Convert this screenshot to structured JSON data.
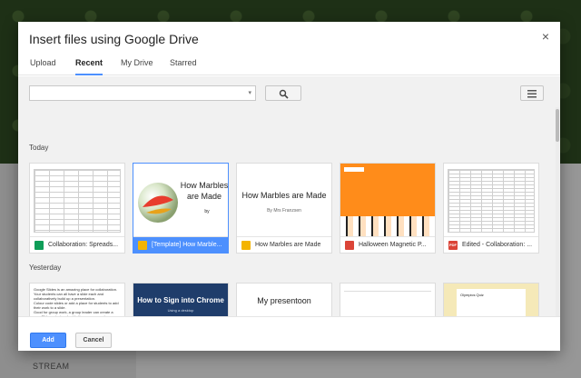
{
  "background": {
    "stream_label": "STREAM"
  },
  "dialog": {
    "title": "Insert files using Google Drive",
    "close_glyph": "×",
    "tabs": [
      {
        "label": "Upload",
        "active": false
      },
      {
        "label": "Recent",
        "active": true
      },
      {
        "label": "My Drive",
        "active": false
      },
      {
        "label": "Starred",
        "active": false
      }
    ],
    "search": {
      "value": "",
      "placeholder": "",
      "caret": "▾",
      "button_icon": "search-icon"
    },
    "view_toggle_icon": "list-view-icon",
    "sections": [
      {
        "label": "Today",
        "files": [
          {
            "name": "Collaboration: Spreads...",
            "type": "sheet",
            "icon": "sheets-icon",
            "selected": false
          },
          {
            "name": "[Template] How Marble...",
            "type": "slide",
            "icon": "slides-icon",
            "selected": true,
            "thumb_title": "How Marbles are Made",
            "thumb_sub": "by"
          },
          {
            "name": "How Marbles are Made",
            "type": "slide",
            "icon": "slides-icon",
            "selected": false,
            "thumb_title": "How Marbles are Made",
            "thumb_sub": "By Mrs Franzsen"
          },
          {
            "name": "Halloween Magnetic P...",
            "type": "pdf-image",
            "icon": "image-icon",
            "selected": false
          },
          {
            "name": "Edited - Collaboration: ...",
            "type": "pdf",
            "icon": "pdf-icon",
            "selected": false
          }
        ]
      },
      {
        "label": "Yesterday",
        "files": [
          {
            "name": "",
            "type": "doc",
            "icon": "",
            "selected": false,
            "thumb_lines": [
              "Google Slides is an amazing place for collaboration.",
              "Your students can all have a slide each and collaboratively build up a presentation.",
              "Colour code slides or add a place for students to add their work to a slide.",
              "Good for group work, a group leader can create a new Slide project and add other group members."
            ]
          },
          {
            "name": "",
            "type": "slide-dark",
            "icon": "",
            "selected": false,
            "thumb_title": "How to Sign into Chrome",
            "thumb_sub": "Using a desktop"
          },
          {
            "name": "",
            "type": "slide",
            "icon": "",
            "selected": false,
            "thumb_title": "My presentoon"
          },
          {
            "name": "",
            "type": "doc-blank",
            "icon": "",
            "selected": false
          },
          {
            "name": "",
            "type": "form",
            "icon": "",
            "selected": false,
            "thumb_title": "Olympics Quiz"
          }
        ]
      }
    ],
    "footer": {
      "add_label": "Add",
      "cancel_label": "Cancel"
    }
  },
  "colors": {
    "accent": "#4d90fe",
    "sheets": "#0f9d58",
    "slides": "#f4b400",
    "pdf": "#db4437",
    "halloween": "#ff8c1a"
  }
}
